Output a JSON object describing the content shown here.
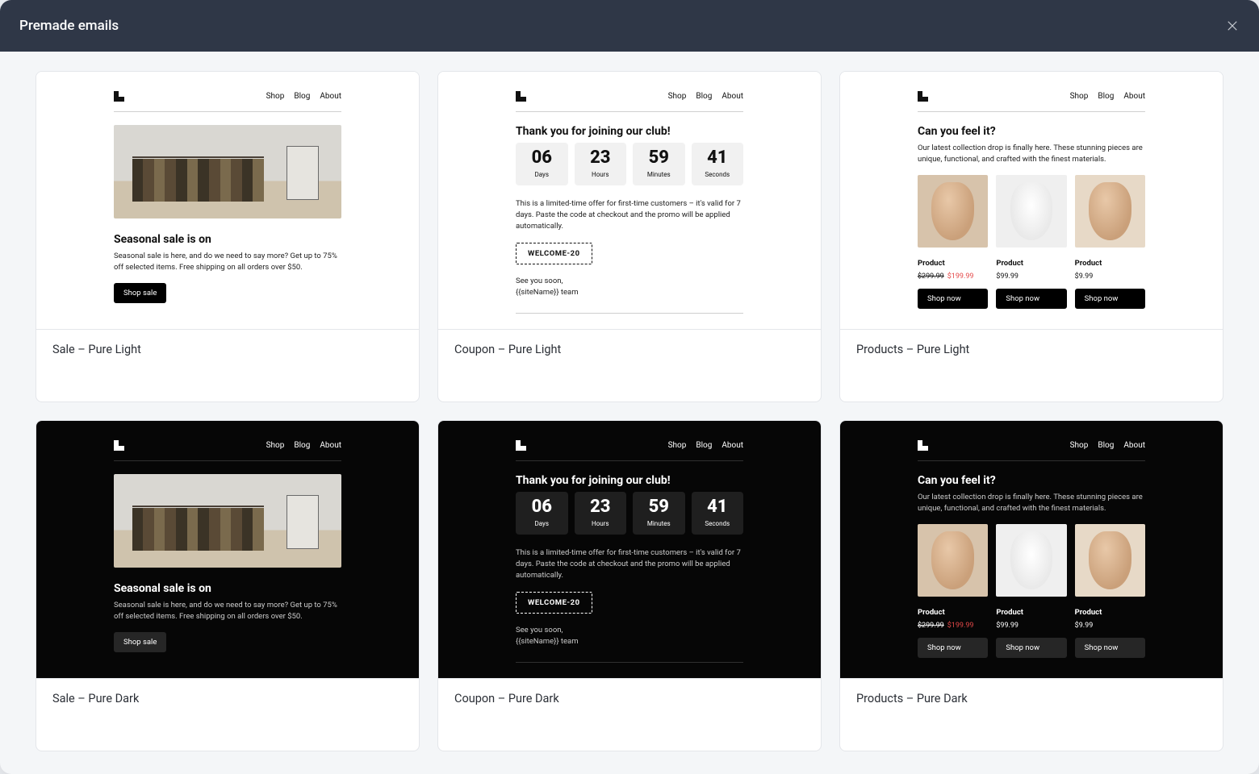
{
  "header": {
    "title": "Premade emails"
  },
  "nav": {
    "shop": "Shop",
    "blog": "Blog",
    "about": "About"
  },
  "sale": {
    "heading": "Seasonal sale is on",
    "body": "Seasonal sale is here, and do we need to say more? Get up to 75% off selected items. Free shipping on all orders over $50.",
    "cta": "Shop sale"
  },
  "coupon": {
    "heading": "Thank you for joining our club!",
    "days_n": "06",
    "days_l": "Days",
    "hours_n": "23",
    "hours_l": "Hours",
    "minutes_n": "59",
    "minutes_l": "Minutes",
    "seconds_n": "41",
    "seconds_l": "Seconds",
    "body": "This is a limited-time offer for first-time customers – it's valid for 7 days. Paste the code at checkout and the promo will be applied automatically.",
    "code": "WELCOME-20",
    "bye1": "See you soon,",
    "bye2": "{{siteName}} team"
  },
  "products": {
    "heading": "Can you feel it?",
    "body": "Our latest collection drop is finally here. These stunning pieces are unique, functional, and crafted with the finest materials.",
    "p1": {
      "title": "Product",
      "old": "$299.99",
      "new": "$199.99",
      "cta": "Shop now"
    },
    "p2": {
      "title": "Product",
      "price": "$99.99",
      "cta": "Shop now"
    },
    "p3": {
      "title": "Product",
      "price": "$9.99",
      "cta": "Shop now"
    }
  },
  "captions": {
    "c1": "Sale – Pure Light",
    "c2": "Coupon – Pure Light",
    "c3": "Products – Pure Light",
    "c4": "Sale – Pure Dark",
    "c5": "Coupon – Pure Dark",
    "c6": "Products – Pure Dark"
  }
}
